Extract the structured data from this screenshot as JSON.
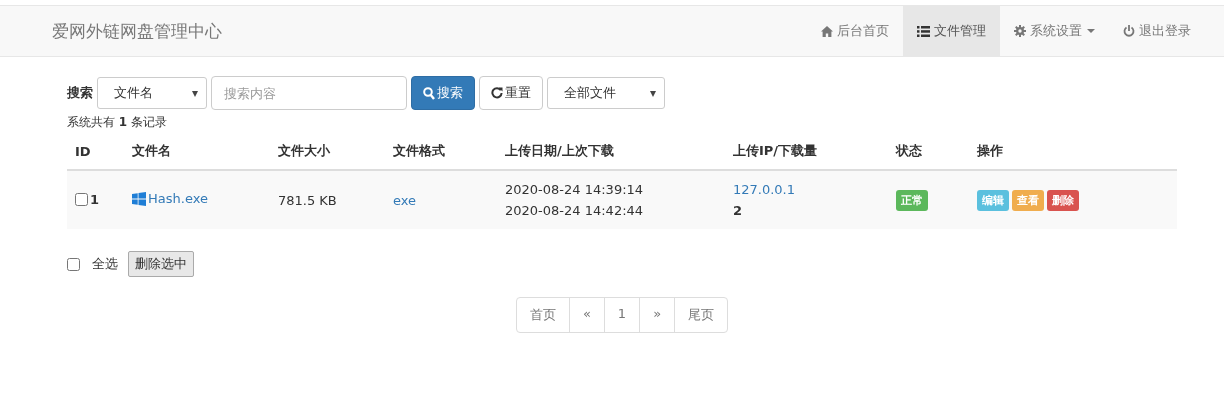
{
  "navbar": {
    "brand": "爱网外链网盘管理中心",
    "items": [
      {
        "label": "后台首页",
        "kind": "home",
        "selected": false,
        "dropdown": false
      },
      {
        "label": "文件管理",
        "kind": "list",
        "selected": true,
        "dropdown": false
      },
      {
        "label": "系统设置",
        "kind": "settings",
        "selected": false,
        "dropdown": true
      },
      {
        "label": "退出登录",
        "kind": "logout",
        "selected": false,
        "dropdown": false
      }
    ]
  },
  "search": {
    "label": "搜索",
    "field_select": "文件名",
    "placeholder": "搜索内容",
    "search_button": "搜索",
    "reset_button": "重置",
    "type_select": "全部文件"
  },
  "record_count": "系统共有 **1** 条记录",
  "table": {
    "columns": [
      "ID",
      "文件名",
      "文件大小",
      "文件格式",
      "上传日期/上次下载",
      "上传IP/下载量",
      "状态",
      "操作"
    ],
    "rows": [
      {
        "checked": false,
        "id": "1",
        "filename": "Hash.exe",
        "size": "781.5 KB",
        "format": "exe",
        "upload_date": "2020-08-24 14:39:14",
        "last_download": "2020-08-24 14:42:44",
        "ip": "127.0.0.1",
        "downloads": "2",
        "status": "正常",
        "kind": "ok",
        "actions": [
          {
            "label": "编辑",
            "kind": "info"
          },
          {
            "label": "查看",
            "kind": "warning"
          },
          {
            "label": "删除",
            "kind": "danger"
          }
        ]
      }
    ]
  },
  "select_all": {
    "label": "全选",
    "checked": false
  },
  "delete_selected": "删除选中",
  "pagination": [
    {
      "label": "首页"
    },
    {
      "label": "«"
    },
    {
      "label": "1"
    },
    {
      "label": "»"
    },
    {
      "label": "尾页"
    }
  ]
}
